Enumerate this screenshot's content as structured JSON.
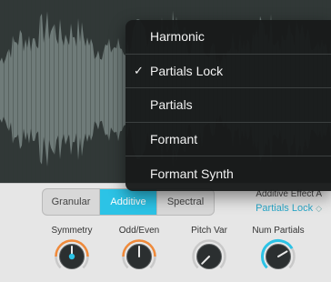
{
  "menu": {
    "items": [
      {
        "label": "Harmonic"
      },
      {
        "label": "Partials Lock"
      },
      {
        "label": "Partials"
      },
      {
        "label": "Formant"
      },
      {
        "label": "Formant Synth"
      }
    ],
    "checked_index": 1,
    "check_glyph": "✓"
  },
  "mode_selector": {
    "options": [
      "Granular",
      "Additive",
      "Spectral"
    ],
    "active_index": 1
  },
  "additive_effect": {
    "title": "Additive Effect A",
    "value": "Partials Lock",
    "chevron_glyph": "◇"
  },
  "knobs": [
    {
      "label": "Symmetry",
      "value": 0.5,
      "has_dot": true
    },
    {
      "label": "Odd/Even",
      "value": 0.5,
      "has_dot": false
    },
    {
      "label": "Pitch Var",
      "value": 0.0,
      "has_dot": false
    },
    {
      "label": "Num Partials",
      "value": 0.72,
      "has_dot": false
    }
  ],
  "colors": {
    "accent": "#2cc3e6",
    "orange": "#f08a3a",
    "waveform": "#6f7b79",
    "waveform_bg": "#313837",
    "menu_bg": "#181a1a"
  }
}
